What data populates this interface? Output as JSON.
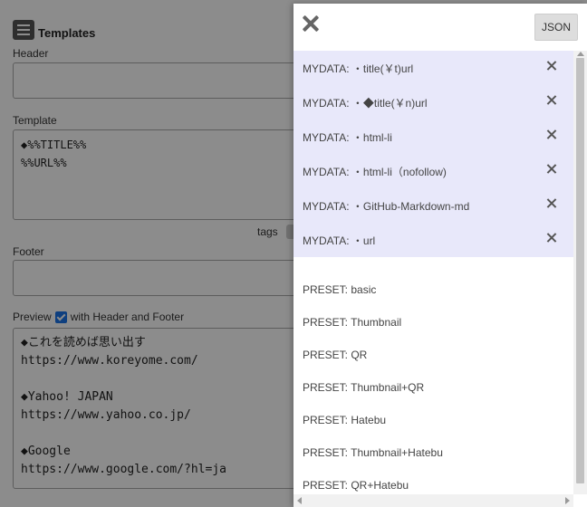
{
  "background": {
    "title": "Templates",
    "header_label": "Header",
    "template_label": "Template",
    "template_value": "◆%%TITLE%%\n%%URL%%",
    "tags_label": "tags",
    "footer_label": "Footer",
    "preview_label": "Preview",
    "with_header_footer_label": "with Header and Footer",
    "preview_text": "◆これを読めば思い出す\nhttps://www.koreyome.com/\n\n◆Yahoo! JAPAN\nhttps://www.yahoo.co.jp/\n\n◆Google\nhttps://www.google.com/?hl=ja"
  },
  "drawer": {
    "json_button": "JSON",
    "mydata_items": [
      {
        "label": "MYDATA: ・title(￥t)url"
      },
      {
        "label": "MYDATA: ・◆title(￥n)url"
      },
      {
        "label": "MYDATA: ・html-li"
      },
      {
        "label": "MYDATA: ・html-li（nofollow)"
      },
      {
        "label": "MYDATA: ・GitHub-Markdown-md"
      },
      {
        "label": "MYDATA: ・url"
      }
    ],
    "preset_items": [
      {
        "label": "PRESET: basic"
      },
      {
        "label": "PRESET: Thumbnail"
      },
      {
        "label": "PRESET: QR"
      },
      {
        "label": "PRESET: Thumbnail+QR"
      },
      {
        "label": "PRESET: Hatebu"
      },
      {
        "label": "PRESET: Thumbnail+Hatebu"
      },
      {
        "label": "PRESET: QR+Hatebu"
      }
    ]
  },
  "colors": {
    "mydata_bg": "#e8e8fa",
    "checkbox": "#1a73e8",
    "overlay": "rgba(0,0,0,0.45)"
  }
}
